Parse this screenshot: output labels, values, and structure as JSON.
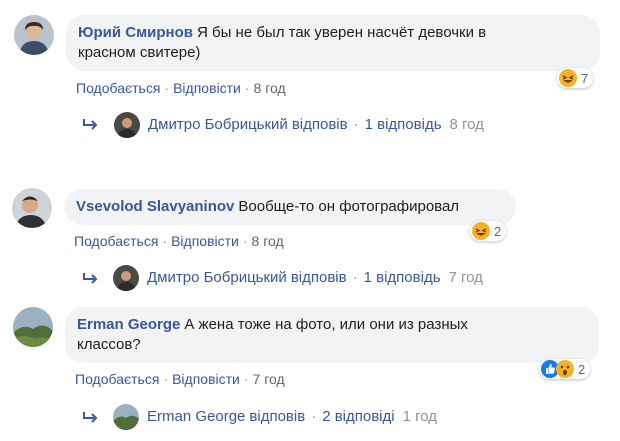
{
  "comments": [
    {
      "author": "Юрий Смирнов",
      "text_line1": "Я бы не был так уверен насчёт девочки в",
      "text_line2": "красном свитере)",
      "like_label": "Подобається",
      "reply_label": "Відповісти",
      "time": "8 год",
      "reaction_count": "7",
      "reaction_icon": "haha-icon",
      "reply_summary": {
        "author": "Дмитро Бобрицький",
        "verb": "відповів",
        "count": "1 відповідь",
        "time": "8 год"
      }
    },
    {
      "author": "Vsevolod Slavyaninov",
      "text_line1": "Вообще-то он фотографировал",
      "like_label": "Подобається",
      "reply_label": "Відповісти",
      "time": "8 год",
      "reaction_count": "2",
      "reaction_icon": "haha-icon",
      "reply_summary": {
        "author": "Дмитро Бобрицький",
        "verb": "відповів",
        "count": "1 відповідь",
        "time": "7 год"
      }
    },
    {
      "author": "Erman George",
      "text_line1": "А жена тоже на фото, или они из разных",
      "text_line2": "классов?",
      "like_label": "Подобається",
      "reply_label": "Відповісти",
      "time": "7 год",
      "reaction_count": "2",
      "reaction_icons": [
        "like-icon",
        "wow-icon"
      ],
      "reply_summary": {
        "author": "Erman George",
        "verb": "відповів",
        "count": "2 відповіді",
        "time": "1 год"
      }
    }
  ],
  "colors": {
    "link": "#385898",
    "muted": "#606770",
    "bubble": "#f2f3f5",
    "reaction_yellow": "#f7b125",
    "like_blue": "#1877f2"
  }
}
